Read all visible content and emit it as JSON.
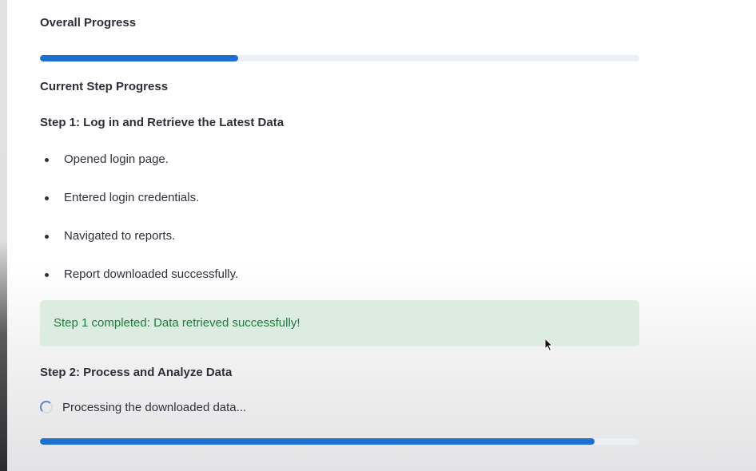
{
  "overall": {
    "title": "Overall Progress",
    "progress_fraction": 0.33
  },
  "current_step": {
    "title": "Current Step Progress"
  },
  "step1": {
    "title": "Step 1: Log in and Retrieve the Latest Data",
    "items": [
      "Opened login page.",
      "Entered login credentials.",
      "Navigated to reports.",
      "Report downloaded successfully."
    ],
    "success_message": "Step 1 completed: Data retrieved successfully!"
  },
  "step2": {
    "title": "Step 2: Process and Analyze Data",
    "status_text": "Processing the downloaded data...",
    "progress_fraction": 0.925
  },
  "colors": {
    "progress_fill": "#1f6fd1",
    "progress_track": "#eceff3",
    "success_bg": "#dcece1",
    "success_text": "#1f7a3d"
  },
  "icons": {
    "spinner": "loading-spinner-icon",
    "cursor": "mouse-pointer-icon",
    "bullet": "bullet-dot-icon"
  }
}
